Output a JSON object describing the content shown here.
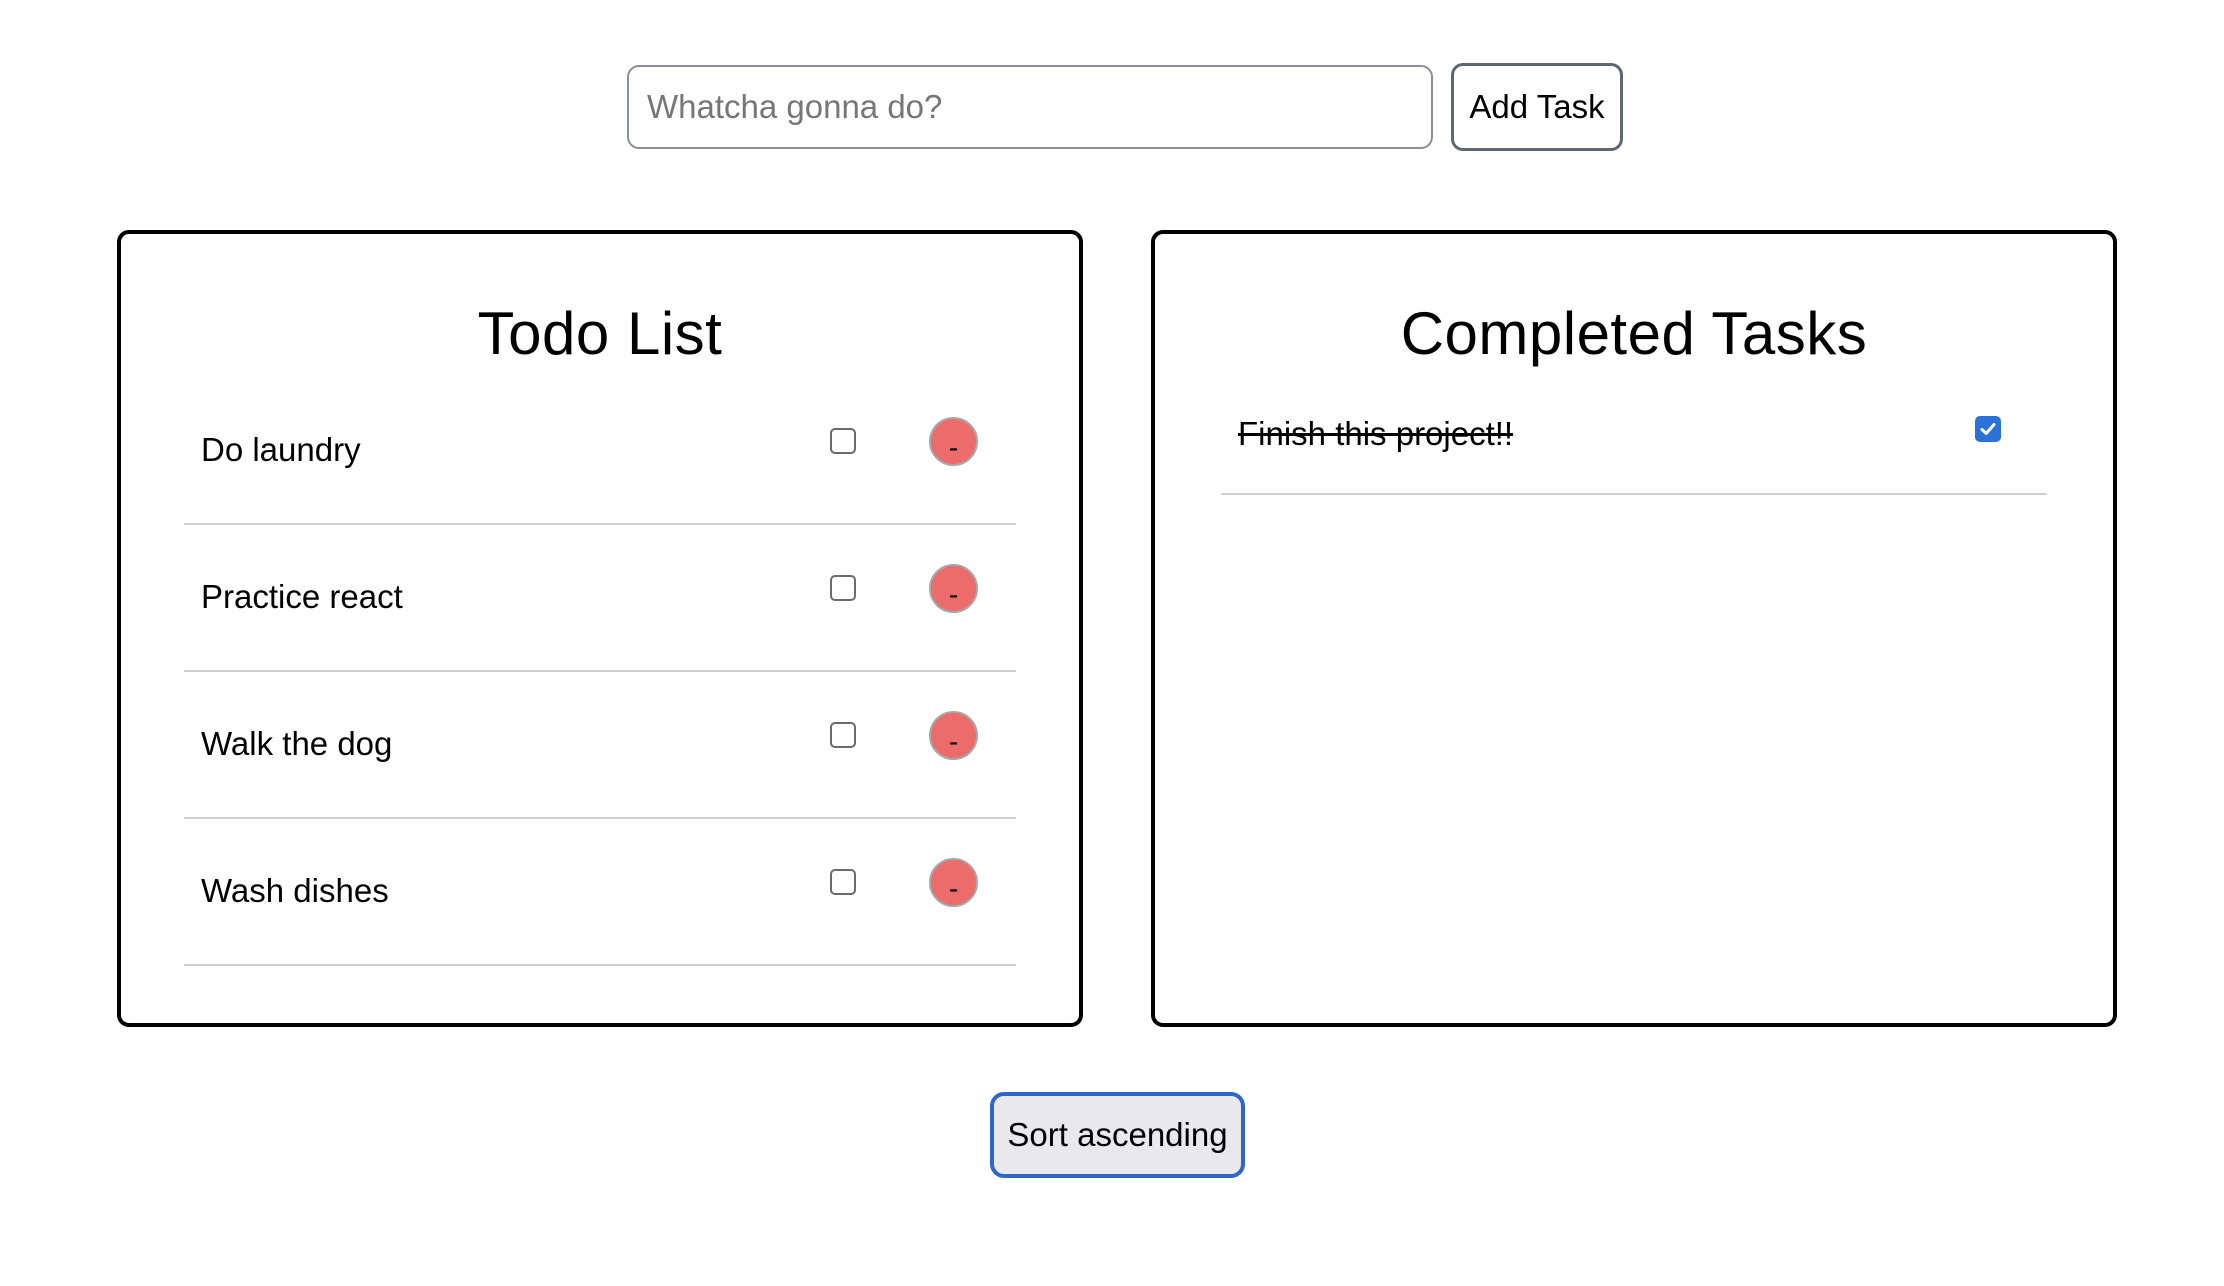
{
  "add_bar": {
    "input_value": "",
    "input_placeholder": "Whatcha gonna do?",
    "add_label": "Add Task"
  },
  "todo": {
    "title": "Todo List",
    "remove_label": "-",
    "items": [
      {
        "label": "Do laundry",
        "checked": false
      },
      {
        "label": "Practice react",
        "checked": false
      },
      {
        "label": "Walk the dog",
        "checked": false
      },
      {
        "label": "Wash dishes",
        "checked": false
      }
    ]
  },
  "completed": {
    "title": "Completed Tasks",
    "items": [
      {
        "label": "Finish this project!!",
        "checked": true
      }
    ]
  },
  "sort": {
    "label": "Sort ascending"
  },
  "colors": {
    "remove_button": "#ec6b6b",
    "checkbox_checked": "#2a72d8",
    "sort_border": "#2f67c8"
  }
}
